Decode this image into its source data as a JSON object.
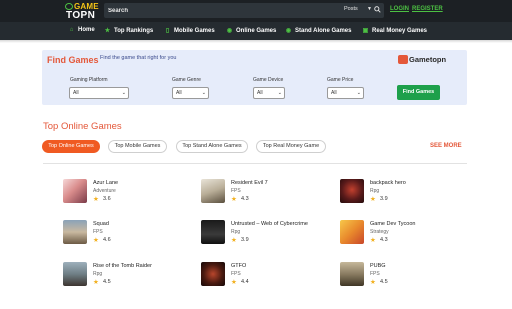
{
  "header": {
    "logo_line1": "GAME",
    "logo_line2": "TOPN",
    "search_placeholder": "Search",
    "search_category": "Posts",
    "login_label": "LOGIN",
    "register_label": "REGISTER"
  },
  "nav": {
    "items": [
      {
        "label": "Home",
        "icon": "home-icon"
      },
      {
        "label": "Top Rankings",
        "icon": "trophy-icon"
      },
      {
        "label": "Mobile Games",
        "icon": "mobile-icon"
      },
      {
        "label": "Online Games",
        "icon": "gamepad-icon"
      },
      {
        "label": "Stand Alone Games",
        "icon": "gamepad-icon"
      },
      {
        "label": "Real Money Games",
        "icon": "money-icon"
      }
    ]
  },
  "finder": {
    "title": "Find Games",
    "subtitle": "Find the game that right for you",
    "logo_text": "Gametopn",
    "platform_label": "Gaming Platform",
    "platform_value": "All",
    "genre_label": "Game Genre",
    "genre_value": "All",
    "device_label": "Game Device",
    "device_value": "All",
    "price_label": "Game Price",
    "price_value": "All",
    "button_label": "Find Games"
  },
  "section": {
    "title": "Top Online Games",
    "tabs": [
      "Top Online Games",
      "Top Mobile Games",
      "Top Stand Alone Games",
      "Top Real Money Game"
    ],
    "active_tab": "Top Online Games",
    "more_label": "SEE MORE"
  },
  "games": [
    {
      "name": "Azur Lane",
      "genre": "Adventure",
      "rating": "3.6"
    },
    {
      "name": "Resident Evil 7",
      "genre": "FPS",
      "rating": "4.3"
    },
    {
      "name": "backpack hero",
      "genre": "Rpg",
      "rating": "3.9"
    },
    {
      "name": "Squad",
      "genre": "FPS",
      "rating": "4.6"
    },
    {
      "name": "Untrusted – Web of Cybercrime",
      "genre": "Rpg",
      "rating": "3.9"
    },
    {
      "name": "Game Dev Tycoon",
      "genre": "Strategy",
      "rating": "4.3"
    },
    {
      "name": "Rise of the Tomb Raider",
      "genre": "Rpg",
      "rating": "4.5"
    },
    {
      "name": "GTFO",
      "genre": "FPS",
      "rating": "4.4"
    },
    {
      "name": "PUBG",
      "genre": "FPS",
      "rating": "4.5"
    }
  ],
  "colors": {
    "accent": "#e4583a",
    "brand_green": "#4cc043",
    "header_bg": "#1c2024",
    "nav_bg": "#252b30",
    "button_green": "#1ea04b",
    "star": "#f2b01e"
  }
}
